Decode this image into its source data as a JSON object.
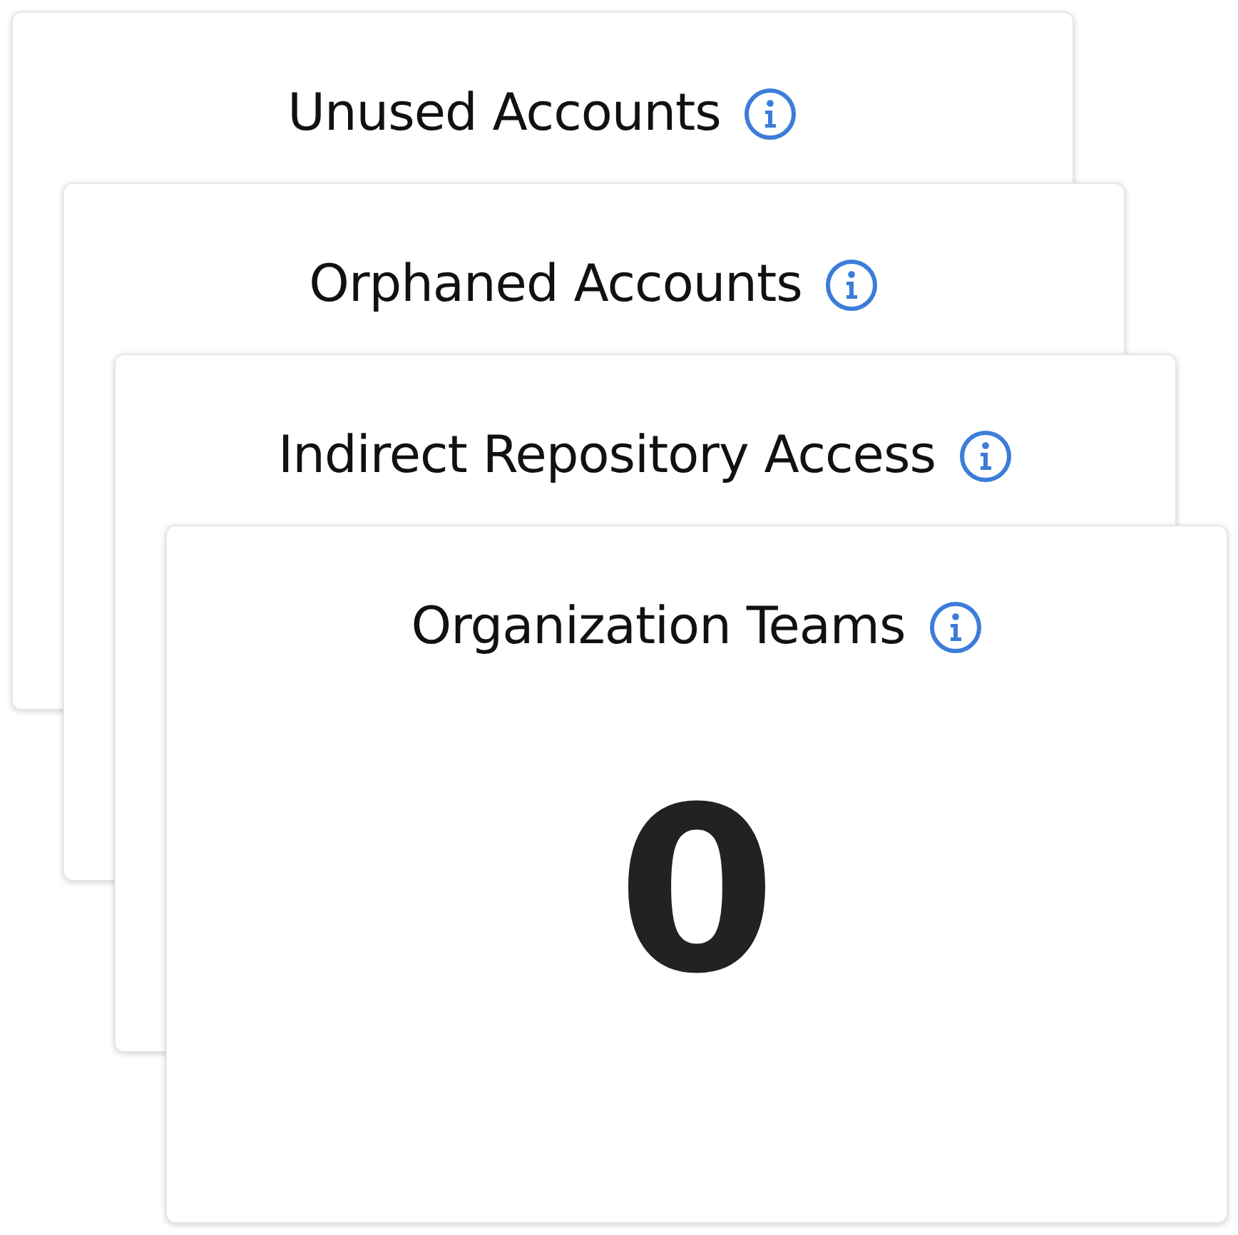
{
  "cards": [
    {
      "title": "Unused Accounts"
    },
    {
      "title": "Orphaned Accounts"
    },
    {
      "title": "Indirect Repository Access"
    },
    {
      "title": "Organization Teams",
      "value": "0"
    }
  ]
}
